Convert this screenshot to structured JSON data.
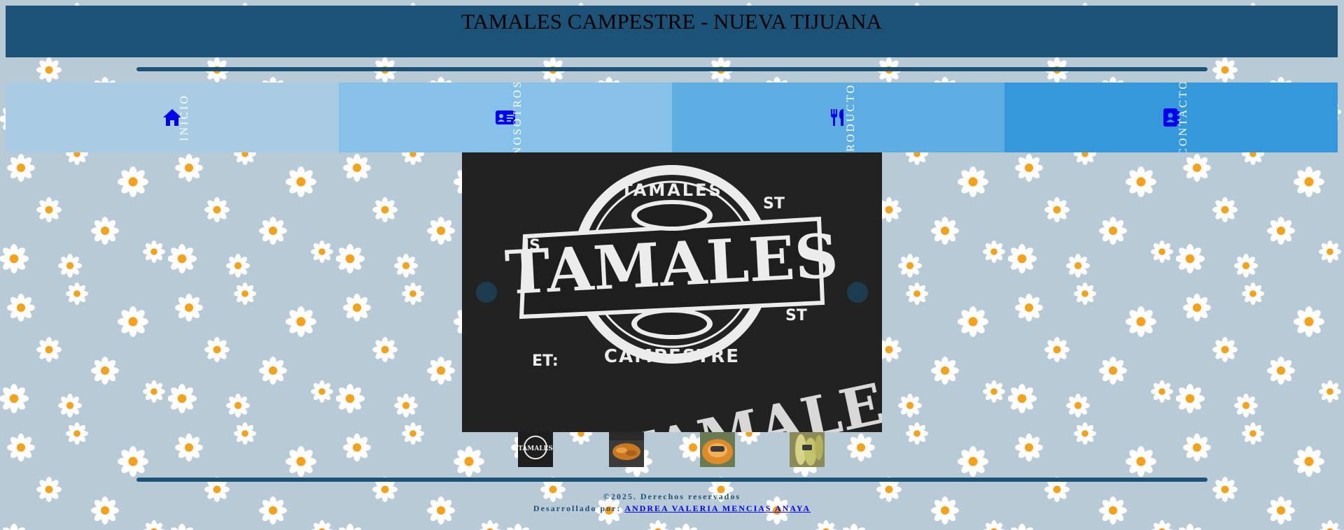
{
  "header": {
    "title": "TAMALES CAMPESTRE - NUEVA TIJUANA"
  },
  "nav": {
    "items": [
      {
        "label": "INICIO",
        "icon": "home-icon",
        "bg": "#a9cce3"
      },
      {
        "label": "NOSOTROS",
        "icon": "id-card-icon",
        "bg": "#85c1e9"
      },
      {
        "label": "PRODUCTOS",
        "icon": "utensils-icon",
        "bg": "#5dade2"
      },
      {
        "label": "CONTACTO",
        "icon": "address-book-icon",
        "bg": "#3498db"
      }
    ],
    "icon_color": "#0000ee"
  },
  "carousel": {
    "slide_text": {
      "top": "TAMALES",
      "main": "TAMALES",
      "bottom": "CAMPESTRE",
      "left_mark": "JS",
      "right_mark_top": "ST",
      "right_mark_bottom": "ST",
      "est": "ET:",
      "shirt": "TAMALES"
    },
    "prev_icon": "chevron-left-icon",
    "next_icon": "chevron-right-icon"
  },
  "thumbnails": [
    {
      "name": "thumb-logo",
      "mini_text": "TAMALES"
    },
    {
      "name": "thumb-tamales-plate"
    },
    {
      "name": "thumb-tamales-bowl"
    },
    {
      "name": "thumb-corn-husks"
    }
  ],
  "footer": {
    "copyright": "©2025. Derechos reservados",
    "developed_by": "Desarrollado por:",
    "author": "ANDREA VALERIA MENCIAS ANAYA"
  },
  "colors": {
    "primary": "#1b5276",
    "background": "#b7cad6"
  }
}
